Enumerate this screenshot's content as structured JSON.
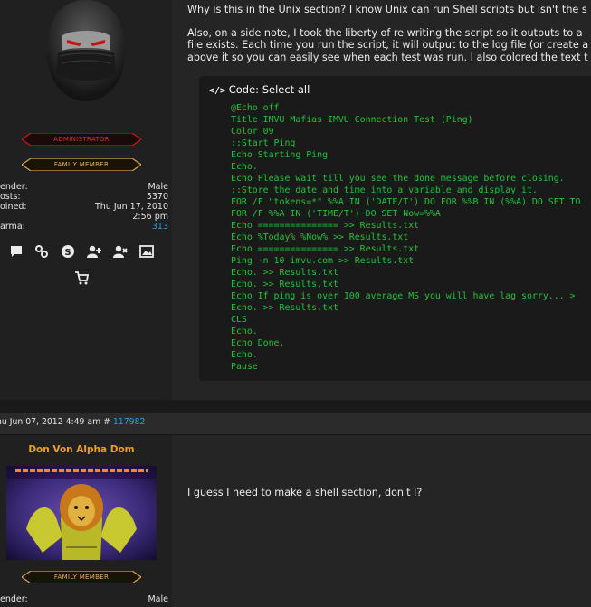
{
  "post1": {
    "rank_primary": "ADMINISTRATOR",
    "rank_secondary": "FAMILY MEMBER",
    "profile": [
      {
        "key": "ender:",
        "value": "Male"
      },
      {
        "key": "osts:",
        "value": "5370"
      },
      {
        "key": "oined:",
        "value": "Thu Jun 17, 2010"
      },
      {
        "key": "",
        "value": "2:56 pm"
      },
      {
        "key": "arma:",
        "value": "313"
      }
    ],
    "contact_icons": [
      "comment-icon",
      "link-icon",
      "skype-icon",
      "add-friend-icon",
      "remove-friend-icon",
      "gallery-icon",
      "shopping-cart-icon"
    ],
    "message_lines": [
      "Why is this in the Unix section? I know Unix can run Shell scripts but isn't the s",
      "Also, on a side note, I took the liberty of re writing the script so it outputs to a",
      "file exists. Each time you run the script, it will output to the log file (or create a",
      "above it so you can easily see when each test was run. I also colored the text t"
    ],
    "code_header": "Code: Select all",
    "code_lines": [
      "@Echo off",
      "Title IMVU Mafias IMVU Connection Test (Ping)",
      "Color 09",
      "::Start Ping",
      "Echo Starting Ping",
      "Echo.",
      "Echo Please wait till you see the done message before closing.",
      "::Store the date and time into a variable and display it.",
      "FOR /F \"tokens=*\" %%A IN ('DATE/T') DO FOR %%B IN (%%A) DO SET TO",
      "FOR /F %%A IN ('TIME/T') DO SET Now=%%A",
      "Echo =============== >> Results.txt",
      "Echo %Today% %Now% >> Results.txt",
      "Echo =============== >> Results.txt",
      "Ping -n 10 imvu.com >> Results.txt",
      "Echo. >> Results.txt",
      "Echo. >> Results.txt",
      "Echo If ping is over 100 average MS you will have lag sorry... >",
      "Echo. >> Results.txt",
      "CLS",
      "Echo.",
      "Echo Done.",
      "Echo.",
      "Pause"
    ]
  },
  "post2": {
    "date_prefix": "hu Jun 07, 2012 4:49 am # ",
    "post_id": "117982",
    "author": "Don Von Alpha Dom",
    "rank_secondary": "FAMILY MEMBER",
    "profile": [
      {
        "key": "ender:",
        "value": "Male"
      }
    ],
    "message": "I guess I need to make a shell section, don't I?"
  },
  "colors": {
    "accent_blue": "#2f9ce6",
    "code_green": "#23c23a",
    "author_orange": "#f0a020",
    "rank_red": "#c8181c",
    "rank_gold": "#d6a24a"
  }
}
